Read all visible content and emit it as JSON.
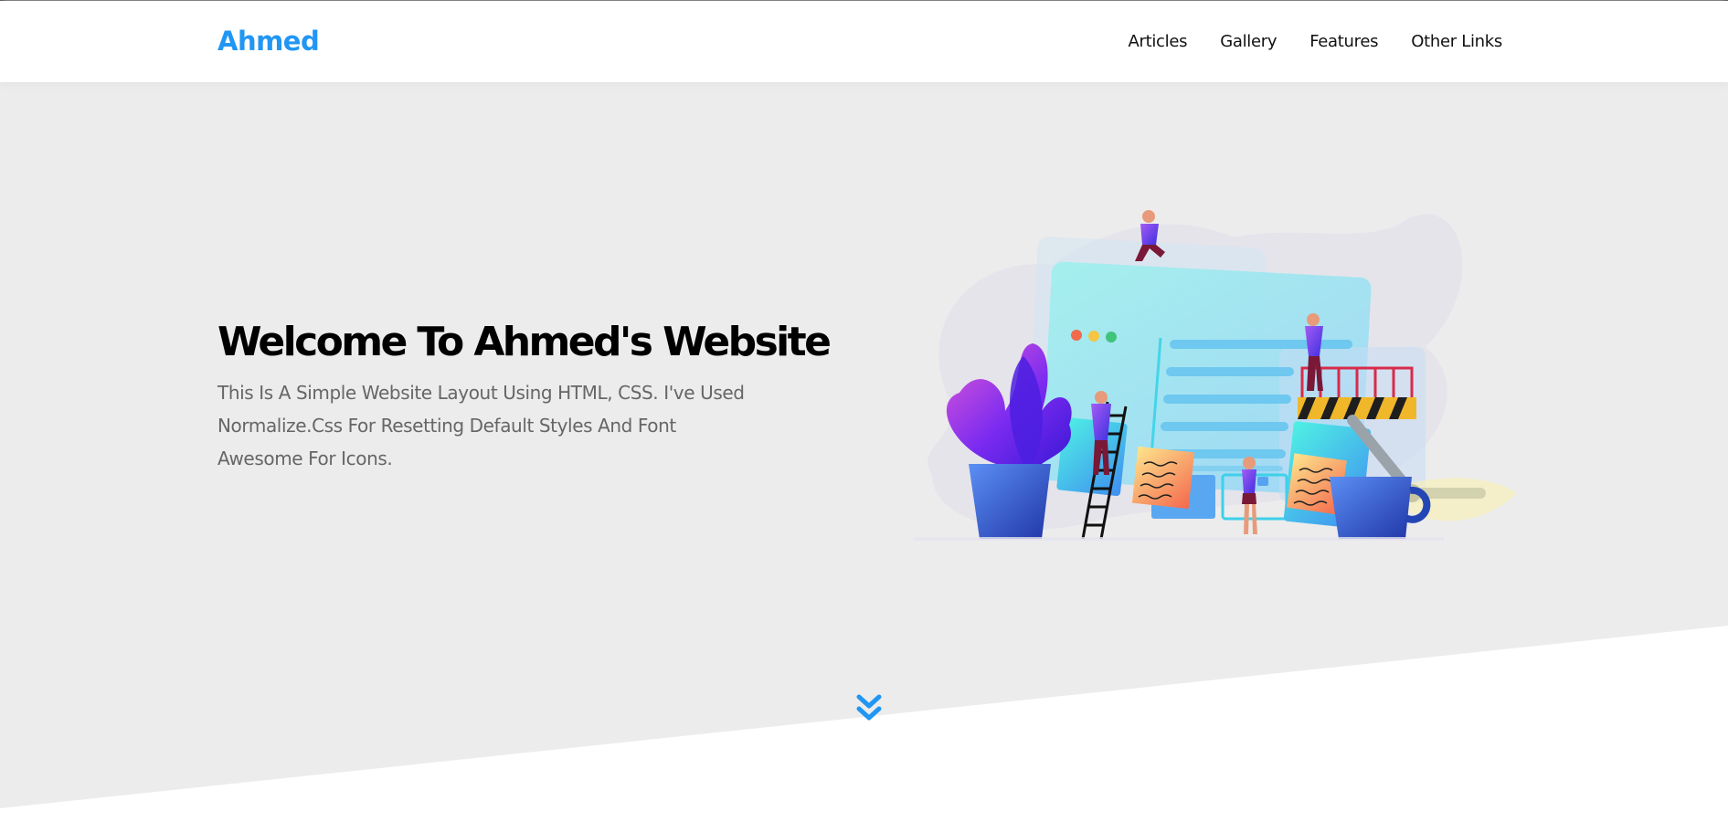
{
  "header": {
    "logo": "Ahmed",
    "nav": [
      {
        "label": "Articles"
      },
      {
        "label": "Gallery"
      },
      {
        "label": "Features"
      },
      {
        "label": "Other Links"
      }
    ]
  },
  "landing": {
    "title": "Welcome To Ahmed's Website",
    "text": "This Is A Simple Website Layout Using HTML, CSS. I've Used Normalize.Css For Resetting Default Styles And Font Awesome For Icons.",
    "image_icon": "team-building-website-illustration",
    "go_down_icon": "angles-down-icon"
  },
  "colors": {
    "brand": "#2196f3",
    "landing_bg": "#ececec",
    "text": "#000000",
    "muted": "#666666"
  }
}
